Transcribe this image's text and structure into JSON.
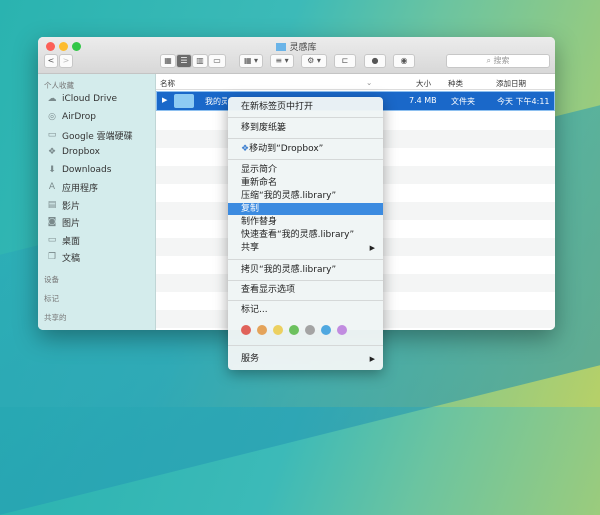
{
  "window": {
    "title": "灵感库"
  },
  "toolbar": {
    "search_placeholder": "搜索",
    "nav_back": "<",
    "nav_forward": ">"
  },
  "sidebar": {
    "favorites_header": "个人收藏",
    "items": [
      {
        "label": "iCloud Drive",
        "icon": "cloud-icon"
      },
      {
        "label": "AirDrop",
        "icon": "airdrop-icon"
      },
      {
        "label": "Google 雲端硬碟",
        "icon": "folder-icon"
      },
      {
        "label": "Dropbox",
        "icon": "dropbox-icon"
      },
      {
        "label": "Downloads",
        "icon": "download-icon"
      },
      {
        "label": "应用程序",
        "icon": "applications-icon"
      },
      {
        "label": "影片",
        "icon": "movies-icon"
      },
      {
        "label": "图片",
        "icon": "pictures-icon"
      },
      {
        "label": "桌面",
        "icon": "desktop-icon"
      },
      {
        "label": "文稿",
        "icon": "documents-icon"
      }
    ],
    "devices_header": "设备",
    "tags_header": "标记",
    "shared_header": "共享的"
  },
  "columns": {
    "name": "名称",
    "size": "大小",
    "kind": "种类",
    "date_added": "添加日期"
  },
  "file": {
    "name": "我的灵感.library",
    "size": "7.4 MB",
    "kind": "文件夹",
    "date": "今天 下午4:11"
  },
  "context_menu": {
    "open_new_tab": "在新标签页中打开",
    "move_trash": "移到废纸篓",
    "move_dropbox": "移动到“Dropbox”",
    "get_info": "显示简介",
    "rename": "重新命名",
    "compress": "压缩“我的灵感.library”",
    "duplicate": "复制",
    "make_alias": "制作替身",
    "quick_look": "快速查看“我的灵感.library”",
    "share": "共享",
    "copy": "拷贝“我的灵感.library”",
    "view_options": "查看显示选项",
    "tags": "标记...",
    "services": "服务",
    "tag_colors": [
      "#e0625a",
      "#e4a35a",
      "#ecd060",
      "#6cc15e",
      "#a4a4a4",
      "#4fa8e0",
      "#c18ce0"
    ]
  }
}
